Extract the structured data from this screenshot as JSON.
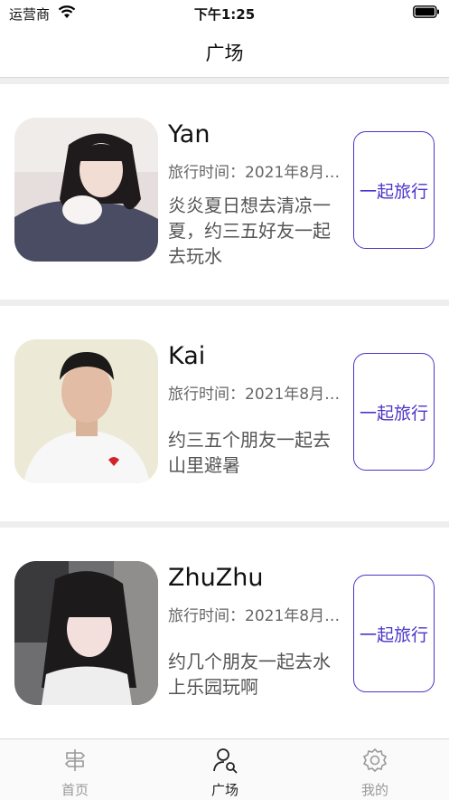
{
  "status_bar": {
    "carrier": "运营商",
    "time": "下午1:25"
  },
  "nav": {
    "title": "广场"
  },
  "posts": [
    {
      "name": "Yan",
      "time": "旅行时间：2021年8月…",
      "desc": "炎炎夏日想去清凉一夏，约三五好友一起去玩水",
      "button": "一起旅行"
    },
    {
      "name": "Kai",
      "time": "旅行时间：2021年8月…",
      "desc": "约三五个朋友一起去山里避暑",
      "button": "一起旅行"
    },
    {
      "name": "ZhuZhu",
      "time": "旅行时间：2021年8月…",
      "desc": "约几个朋友一起去水上乐园玩啊",
      "button": "一起旅行"
    }
  ],
  "tabs": [
    {
      "label": "首页",
      "icon": "signpost-icon",
      "active": false
    },
    {
      "label": "广场",
      "icon": "person-search-icon",
      "active": true
    },
    {
      "label": "我的",
      "icon": "gear-icon",
      "active": false
    }
  ],
  "colors": {
    "accent": "#4a35c8",
    "divider": "#eeeeee",
    "text_secondary": "#666666"
  }
}
